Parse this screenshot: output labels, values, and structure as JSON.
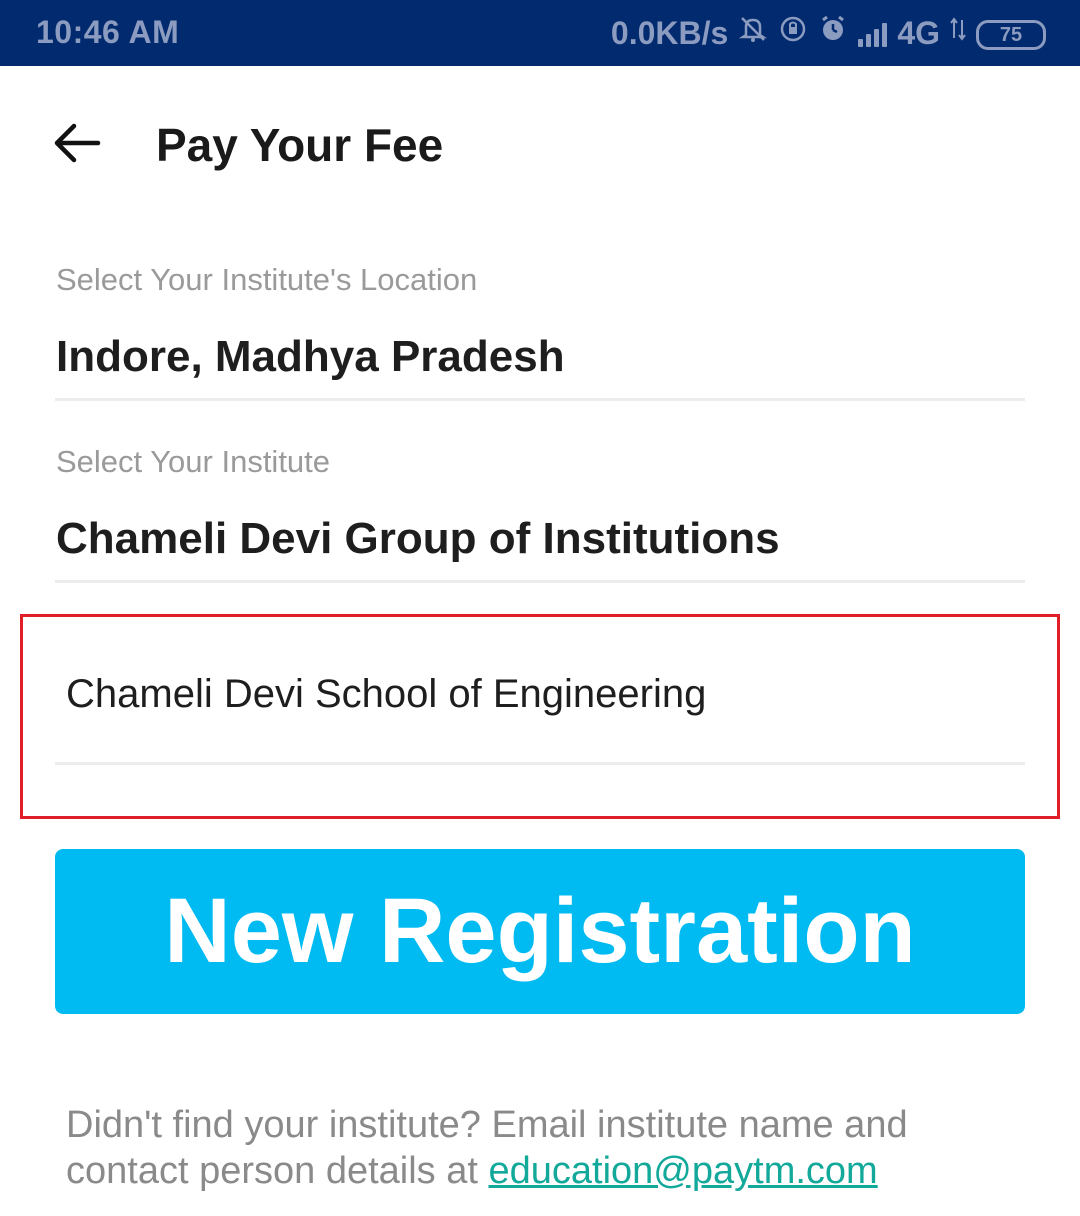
{
  "status_bar": {
    "time": "10:46 AM",
    "network_speed": "0.0KB/s",
    "network_type": "4G",
    "battery": "75",
    "icons": [
      "mute-icon",
      "rotation-lock-icon",
      "alarm-icon",
      "signal-icon",
      "data-arrows-icon",
      "battery-icon"
    ]
  },
  "header": {
    "title": "Pay Your Fee",
    "back_icon": "back-arrow-icon"
  },
  "form": {
    "location_label": "Select Your Institute's Location",
    "location_value": "Indore, Madhya Pradesh",
    "institute_label": "Select Your Institute",
    "institute_value": "Chameli Devi Group of Institutions",
    "sub_institute_value": "Chameli Devi School of Engineering"
  },
  "actions": {
    "new_registration_label": "New Registration"
  },
  "footer": {
    "help_text": "Didn't find your institute? Email institute name and contact person details at ",
    "email_link": "education@paytm.com"
  },
  "colors": {
    "status_bar_bg": "#022a6e",
    "primary_button": "#00baf2",
    "highlight_border": "#e01e2a",
    "link": "#12a99a"
  }
}
